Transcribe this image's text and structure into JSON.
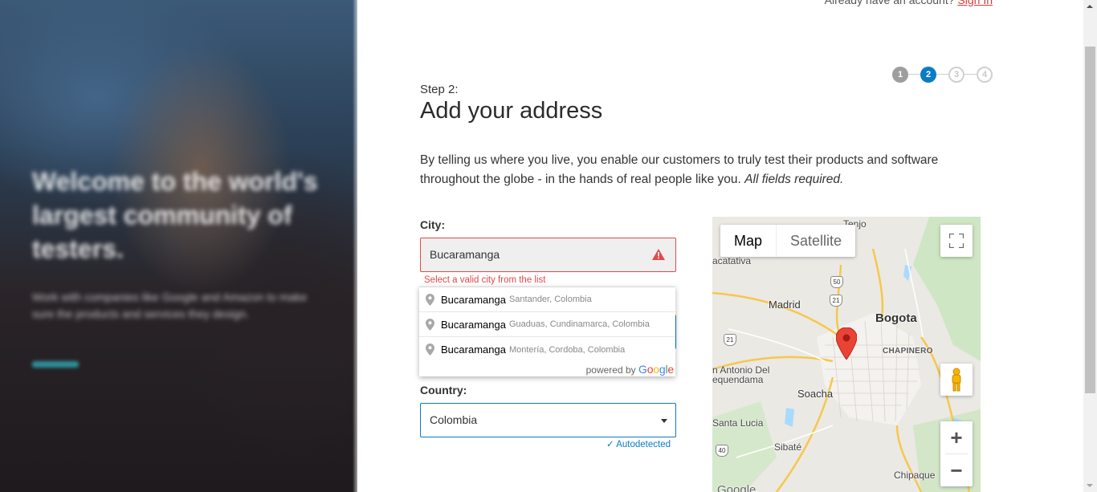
{
  "header": {
    "signin_prompt": "Already have an account?",
    "signin_link": "Sign In"
  },
  "hero": {
    "title": "Welcome to the world's largest community of testers.",
    "subtitle": "Work with companies like Google and Amazon to make sure the products and services they design."
  },
  "stepper": {
    "steps": [
      "1",
      "2",
      "3",
      "4"
    ],
    "current": 2
  },
  "form": {
    "step_label": "Step 2:",
    "title": "Add your address",
    "intro": "By telling us where you live, you enable our customers to truly test their products and software throughout the globe - in the hands of real people like you.",
    "intro_emph": "All fields required.",
    "city": {
      "label": "City:",
      "value": "Bucaramanga",
      "error": "Select a valid city from the list"
    },
    "suggestions": [
      {
        "main": "Bucaramanga",
        "secondary": "Santander, Colombia"
      },
      {
        "main": "Bucaramanga",
        "secondary": "Guaduas, Cundinamarca, Colombia"
      },
      {
        "main": "Bucaramanga",
        "secondary": "Montería, Cordoba, Colombia"
      }
    ],
    "powered_by": "powered by",
    "country": {
      "label": "Country:",
      "value": "Colombia",
      "autodetect": "Autodetected"
    }
  },
  "map": {
    "types": [
      "Map",
      "Satellite"
    ],
    "active_type": "Map",
    "labels": {
      "bogota": "Bogota",
      "chapinero": "CHAPINERO",
      "madrid": "Madrid",
      "soacha": "Soacha",
      "facatativa": "acatativa",
      "tenjo": "Tenjo",
      "antonio": "n Antonio Del",
      "tequendama": "equendama",
      "santa_lucia": "Santa Lucia",
      "sibate": "Sibaté",
      "chipaque": "Chipaque",
      "google": "Google"
    },
    "shields": [
      "50",
      "21",
      "21",
      "40"
    ],
    "pin_color": "#ea4335"
  },
  "colors": {
    "accent": "#0a7bc4",
    "error": "#e04a4a"
  }
}
